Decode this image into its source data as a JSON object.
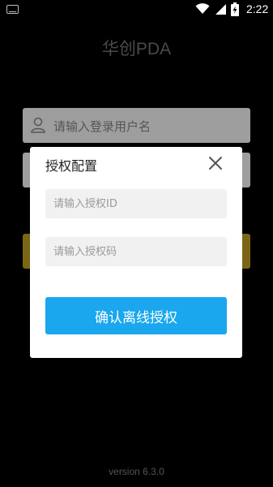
{
  "status_bar": {
    "time": "2:22",
    "icons": [
      "keyboard-icon",
      "wifi-icon",
      "signal-icon",
      "battery-charging-icon"
    ]
  },
  "login": {
    "app_title": "华创PDA",
    "username_placeholder": "请输入登录用户名",
    "version": "version 6.3.0"
  },
  "dialog": {
    "title": "授权配置",
    "auth_id_placeholder": "请输入授权ID",
    "auth_code_placeholder": "请输入授权码",
    "confirm_label": "确认离线授权"
  },
  "colors": {
    "background": "#000000",
    "dialog_bg": "#ffffff",
    "input_bg": "#f1f1f1",
    "confirm_button": "#1aa7ee",
    "login_button_dimmed": "#7b6616"
  }
}
